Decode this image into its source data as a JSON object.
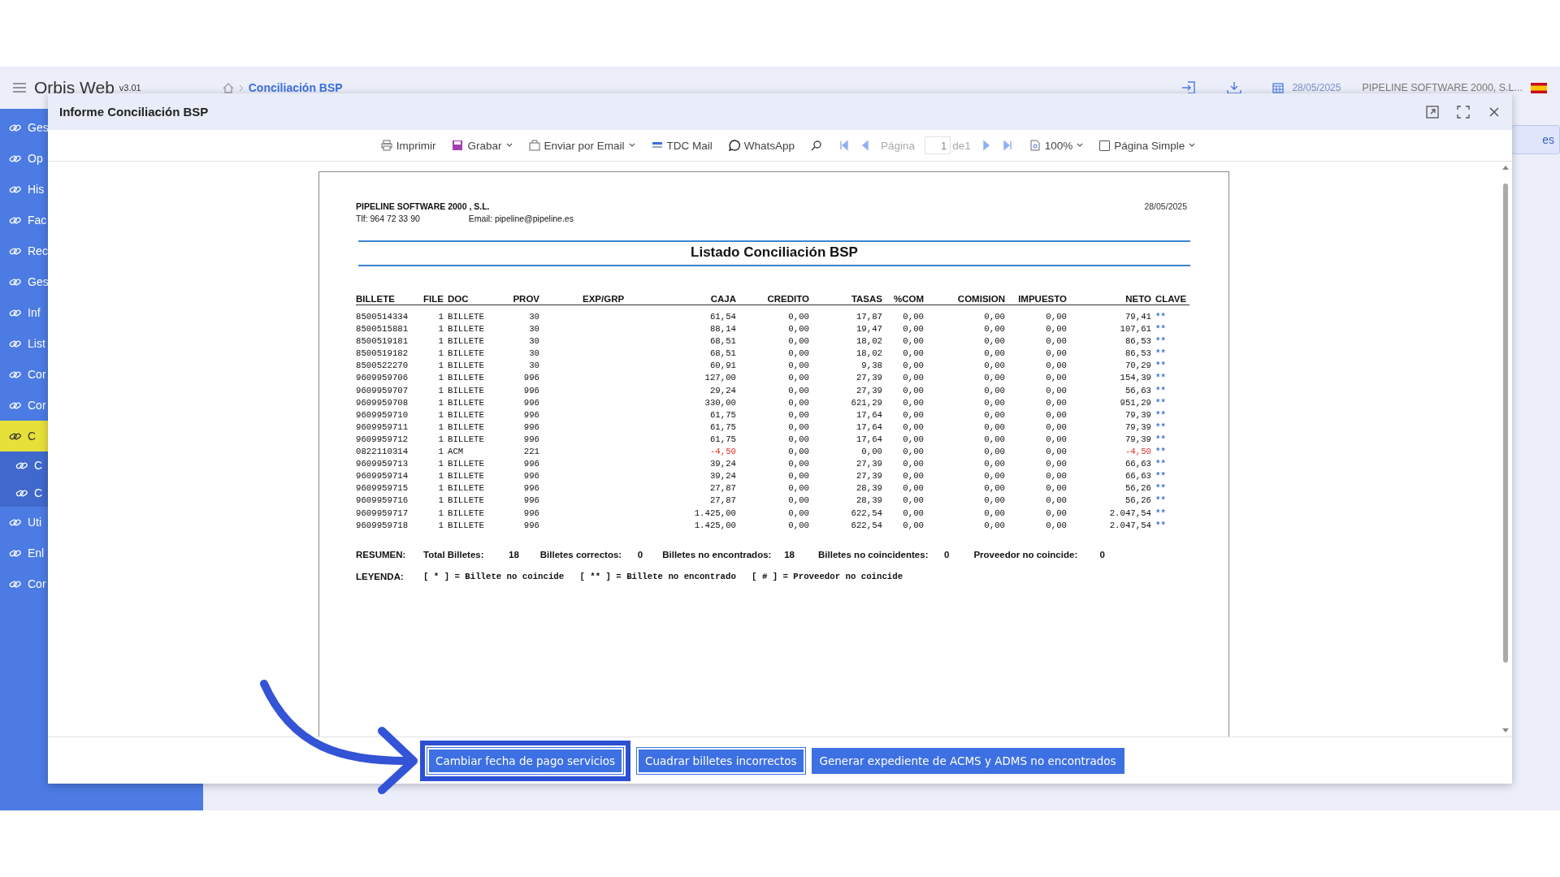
{
  "app": {
    "title": "Orbis Web",
    "version": "v3.01",
    "breadcrumb": "Conciliación BSP",
    "date": "28/05/2025",
    "company": "PIPELINE SOFTWARE 2000, S.L..."
  },
  "sidebar": {
    "items": [
      {
        "label": "Ges",
        "selected": false
      },
      {
        "label": "Op",
        "selected": false
      },
      {
        "label": "His",
        "selected": false
      },
      {
        "label": "Fac",
        "selected": false
      },
      {
        "label": "Rec",
        "selected": false
      },
      {
        "label": "Ges",
        "selected": false
      },
      {
        "label": "Inf",
        "selected": false
      },
      {
        "label": "List",
        "selected": false
      },
      {
        "label": "Cor",
        "selected": false
      },
      {
        "label": "Cor",
        "selected": false
      },
      {
        "label": "C",
        "selected": true,
        "children": [
          {
            "label": "C",
            "selected": false
          },
          {
            "label": "C",
            "selected": false
          }
        ]
      },
      {
        "label": "Uti",
        "selected": false
      },
      {
        "label": "Enl",
        "selected": false
      },
      {
        "label": "Cor",
        "selected": false
      }
    ]
  },
  "background_panel": {
    "button": "es"
  },
  "modal": {
    "title": "Informe Conciliación BSP",
    "toolbar": {
      "print": "Imprimir",
      "save": "Grabar",
      "email": "Enviar por Email",
      "tdc": "TDC Mail",
      "whatsapp": "WhatsApp",
      "page_label": "Página",
      "page_value": "1",
      "page_of": "de1",
      "zoom": "100%",
      "single_page": {
        "label": "Página Simple",
        "checked": false
      }
    },
    "report": {
      "company": "PIPELINE SOFTWARE 2000 , S.L.",
      "phone": "Tlf:  964 72 33 90",
      "email": "Email:  pipeline@pipeline.es",
      "date": "28/05/2025",
      "title": "Listado Conciliación BSP",
      "columns": [
        "BILLETE",
        "FILE",
        "DOC",
        "PROV",
        "EXP/GRP",
        "CAJA",
        "CREDITO",
        "TASAS",
        "%COM",
        "COMISION",
        "IMPUESTO",
        "NETO",
        "CLAVE"
      ],
      "rows": [
        {
          "billete": "8500514334",
          "file": "1",
          "doc": "BILLETE",
          "prov": "30",
          "caja": "61,54",
          "credito": "0,00",
          "tasas": "17,87",
          "com": "0,00",
          "comision": "0,00",
          "impuesto": "0,00",
          "neto": "79,41",
          "clave": "**",
          "negative": false
        },
        {
          "billete": "8500515881",
          "file": "1",
          "doc": "BILLETE",
          "prov": "30",
          "caja": "88,14",
          "credito": "0,00",
          "tasas": "19,47",
          "com": "0,00",
          "comision": "0,00",
          "impuesto": "0,00",
          "neto": "107,61",
          "clave": "**",
          "negative": false
        },
        {
          "billete": "8500519181",
          "file": "1",
          "doc": "BILLETE",
          "prov": "30",
          "caja": "68,51",
          "credito": "0,00",
          "tasas": "18,02",
          "com": "0,00",
          "comision": "0,00",
          "impuesto": "0,00",
          "neto": "86,53",
          "clave": "**",
          "negative": false
        },
        {
          "billete": "8500519182",
          "file": "1",
          "doc": "BILLETE",
          "prov": "30",
          "caja": "68,51",
          "credito": "0,00",
          "tasas": "18,02",
          "com": "0,00",
          "comision": "0,00",
          "impuesto": "0,00",
          "neto": "86,53",
          "clave": "**",
          "negative": false
        },
        {
          "billete": "8500522270",
          "file": "1",
          "doc": "BILLETE",
          "prov": "30",
          "caja": "60,91",
          "credito": "0,00",
          "tasas": "9,38",
          "com": "0,00",
          "comision": "0,00",
          "impuesto": "0,00",
          "neto": "70,29",
          "clave": "**",
          "negative": false
        },
        {
          "billete": "9609959706",
          "file": "1",
          "doc": "BILLETE",
          "prov": "996",
          "caja": "127,00",
          "credito": "0,00",
          "tasas": "27,39",
          "com": "0,00",
          "comision": "0,00",
          "impuesto": "0,00",
          "neto": "154,39",
          "clave": "**",
          "negative": false
        },
        {
          "billete": "9609959707",
          "file": "1",
          "doc": "BILLETE",
          "prov": "996",
          "caja": "29,24",
          "credito": "0,00",
          "tasas": "27,39",
          "com": "0,00",
          "comision": "0,00",
          "impuesto": "0,00",
          "neto": "56,63",
          "clave": "**",
          "negative": false
        },
        {
          "billete": "9609959708",
          "file": "1",
          "doc": "BILLETE",
          "prov": "996",
          "caja": "330,00",
          "credito": "0,00",
          "tasas": "621,29",
          "com": "0,00",
          "comision": "0,00",
          "impuesto": "0,00",
          "neto": "951,29",
          "clave": "**",
          "negative": false
        },
        {
          "billete": "9609959710",
          "file": "1",
          "doc": "BILLETE",
          "prov": "996",
          "caja": "61,75",
          "credito": "0,00",
          "tasas": "17,64",
          "com": "0,00",
          "comision": "0,00",
          "impuesto": "0,00",
          "neto": "79,39",
          "clave": "**",
          "negative": false
        },
        {
          "billete": "9609959711",
          "file": "1",
          "doc": "BILLETE",
          "prov": "996",
          "caja": "61,75",
          "credito": "0,00",
          "tasas": "17,64",
          "com": "0,00",
          "comision": "0,00",
          "impuesto": "0,00",
          "neto": "79,39",
          "clave": "**",
          "negative": false
        },
        {
          "billete": "9609959712",
          "file": "1",
          "doc": "BILLETE",
          "prov": "996",
          "caja": "61,75",
          "credito": "0,00",
          "tasas": "17,64",
          "com": "0,00",
          "comision": "0,00",
          "impuesto": "0,00",
          "neto": "79,39",
          "clave": "**",
          "negative": false
        },
        {
          "billete": "0822110314",
          "file": "1",
          "doc": "ACM",
          "prov": "221",
          "caja": "-4,50",
          "credito": "0,00",
          "tasas": "0,00",
          "com": "0,00",
          "comision": "0,00",
          "impuesto": "0,00",
          "neto": "-4,50",
          "clave": "**",
          "negative": true
        },
        {
          "billete": "9609959713",
          "file": "1",
          "doc": "BILLETE",
          "prov": "996",
          "caja": "39,24",
          "credito": "0,00",
          "tasas": "27,39",
          "com": "0,00",
          "comision": "0,00",
          "impuesto": "0,00",
          "neto": "66,63",
          "clave": "**",
          "negative": false
        },
        {
          "billete": "9609959714",
          "file": "1",
          "doc": "BILLETE",
          "prov": "996",
          "caja": "39,24",
          "credito": "0,00",
          "tasas": "27,39",
          "com": "0,00",
          "comision": "0,00",
          "impuesto": "0,00",
          "neto": "66,63",
          "clave": "**",
          "negative": false
        },
        {
          "billete": "9609959715",
          "file": "1",
          "doc": "BILLETE",
          "prov": "996",
          "caja": "27,87",
          "credito": "0,00",
          "tasas": "28,39",
          "com": "0,00",
          "comision": "0,00",
          "impuesto": "0,00",
          "neto": "56,26",
          "clave": "**",
          "negative": false
        },
        {
          "billete": "9609959716",
          "file": "1",
          "doc": "BILLETE",
          "prov": "996",
          "caja": "27,87",
          "credito": "0,00",
          "tasas": "28,39",
          "com": "0,00",
          "comision": "0,00",
          "impuesto": "0,00",
          "neto": "56,26",
          "clave": "**",
          "negative": false
        },
        {
          "billete": "9609959717",
          "file": "1",
          "doc": "BILLETE",
          "prov": "996",
          "caja": "1.425,00",
          "credito": "0,00",
          "tasas": "622,54",
          "com": "0,00",
          "comision": "0,00",
          "impuesto": "0,00",
          "neto": "2.047,54",
          "clave": "**",
          "negative": false
        },
        {
          "billete": "9609959718",
          "file": "1",
          "doc": "BILLETE",
          "prov": "996",
          "caja": "1.425,00",
          "credito": "0,00",
          "tasas": "622,54",
          "com": "0,00",
          "comision": "0,00",
          "impuesto": "0,00",
          "neto": "2.047,54",
          "clave": "**",
          "negative": false
        }
      ],
      "summary": {
        "label": "RESUMEN:",
        "items": [
          {
            "label": "Total Billetes:",
            "value": "18"
          },
          {
            "label": "Billetes correctos:",
            "value": "0"
          },
          {
            "label": "Billetes no encontrados:",
            "value": "18"
          },
          {
            "label": "Billetes no coincidentes:",
            "value": "0"
          },
          {
            "label": "Proveedor no coincide:",
            "value": "0"
          }
        ]
      },
      "legend": {
        "label": "LEYENDA:",
        "text": "[ * ] = Billete no coincide   [ ** ] = Billete no encontrado   [ # ] = Proveedor no coincide"
      }
    },
    "buttons": [
      {
        "label": "Cambiar fecha de pago servicios",
        "highlighted": true
      },
      {
        "label": "Cuadrar billetes incorrectos",
        "highlighted": false
      },
      {
        "label": "Generar expediente de ACMS y ADMS no encontrados",
        "highlighted": false
      }
    ]
  }
}
